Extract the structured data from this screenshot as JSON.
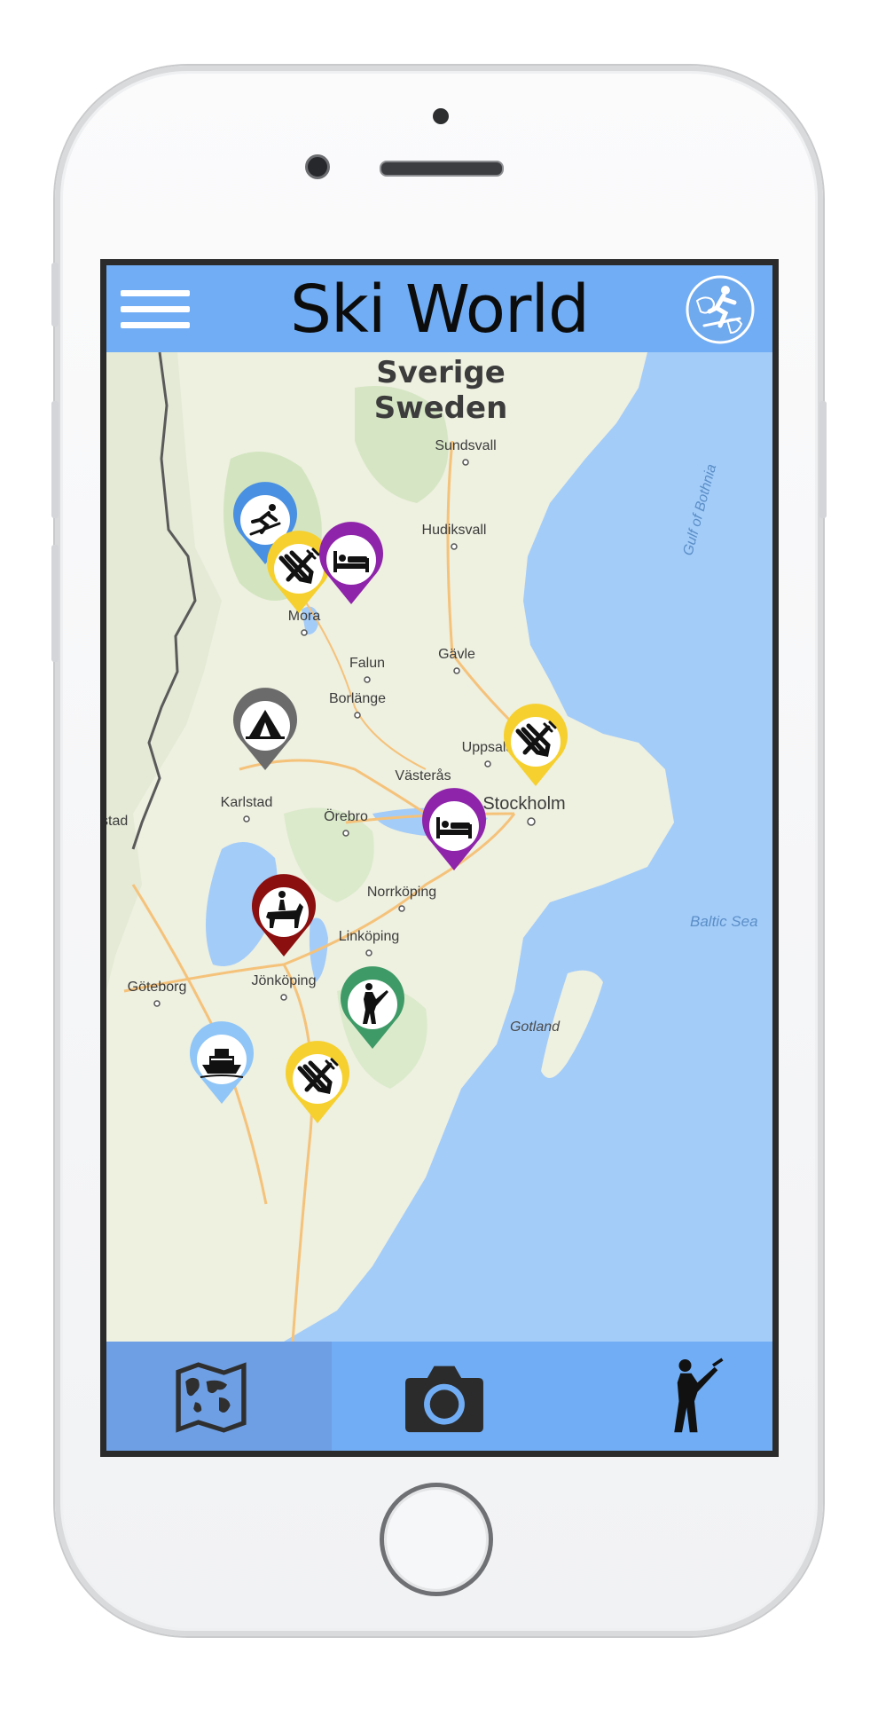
{
  "app": {
    "title": "Ski World"
  },
  "header": {
    "menu_icon": "hamburger-menu-icon",
    "logo_icon": "ski-world-globe-logo"
  },
  "map": {
    "country_label_1": "Sverige",
    "country_label_2": "Sweden",
    "places": [
      {
        "name": "Sundsvall"
      },
      {
        "name": "Hudiksvall"
      },
      {
        "name": "Mora"
      },
      {
        "name": "Falun"
      },
      {
        "name": "Gävle"
      },
      {
        "name": "Borlänge"
      },
      {
        "name": "Uppsala"
      },
      {
        "name": "Västerås"
      },
      {
        "name": "Stockholm"
      },
      {
        "name": "Karlstad"
      },
      {
        "name": "Örebro"
      },
      {
        "name": "stad"
      },
      {
        "name": "Norrköping"
      },
      {
        "name": "Linköping"
      },
      {
        "name": "Göteborg"
      },
      {
        "name": "Jönköping"
      },
      {
        "name": "Gotland"
      }
    ],
    "water_labels": [
      "Gulf of Bothnia",
      "Baltic Sea"
    ],
    "pins": [
      {
        "type": "ski-resort",
        "icon": "skier-icon",
        "color": "#4a90e2"
      },
      {
        "type": "restaurant",
        "icon": "fork-knife-icon",
        "color": "#f6d02f"
      },
      {
        "type": "hotel",
        "icon": "bed-icon",
        "color": "#8e24aa"
      },
      {
        "type": "camping",
        "icon": "tent-icon",
        "color": "#6b6b6b"
      },
      {
        "type": "restaurant",
        "icon": "fork-knife-icon",
        "color": "#f6d02f"
      },
      {
        "type": "hotel",
        "icon": "bed-icon",
        "color": "#8e24aa"
      },
      {
        "type": "horse-riding",
        "icon": "horse-rider-icon",
        "color": "#8b0f0f"
      },
      {
        "type": "golf",
        "icon": "golfer-icon",
        "color": "#3e9a66"
      },
      {
        "type": "cruise",
        "icon": "ship-icon",
        "color": "#8fc5f7"
      },
      {
        "type": "restaurant",
        "icon": "fork-knife-icon",
        "color": "#f6d02f"
      }
    ]
  },
  "tabbar": {
    "tabs": [
      {
        "icon": "world-map-icon",
        "active": true
      },
      {
        "icon": "camera-icon",
        "active": false
      },
      {
        "icon": "golfer-icon",
        "active": false
      }
    ]
  },
  "colors": {
    "accent": "#71adf4",
    "active_tab": "#6e9fe4",
    "sea": "#a3ccf9",
    "land": "#eef0e0"
  }
}
